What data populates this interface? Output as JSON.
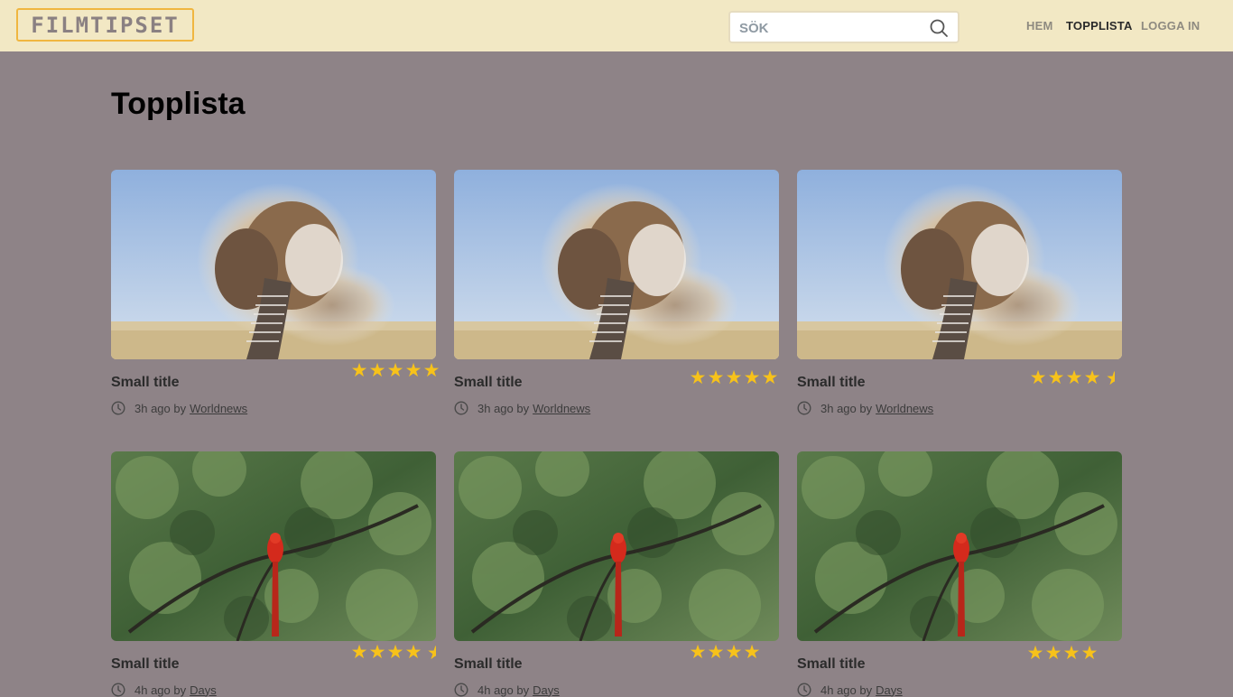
{
  "header": {
    "logo": "FILMTIPSET",
    "search_placeholder": "SÖK",
    "nav": {
      "home": "HEM",
      "toplist": "TOPPLISTA",
      "login": "LOGGA IN"
    }
  },
  "page_title": "Topplista",
  "cards": [
    {
      "title": "Small title",
      "time": "3h ago by",
      "author": "Worldnews",
      "rating": 5,
      "image": "elephant"
    },
    {
      "title": "Small title",
      "time": "3h ago by",
      "author": "Worldnews",
      "rating": 5,
      "image": "elephant"
    },
    {
      "title": "Small title",
      "time": "3h ago by",
      "author": "Worldnews",
      "rating": 4.5,
      "image": "elephant"
    },
    {
      "title": "Small title",
      "time": "4h ago by",
      "author": "Days",
      "rating": 4.5,
      "image": "parrot"
    },
    {
      "title": "Small title",
      "time": "4h ago by",
      "author": "Days",
      "rating": 4,
      "image": "parrot"
    },
    {
      "title": "Small title",
      "time": "4h ago by",
      "author": "Days",
      "rating": 4,
      "image": "parrot"
    }
  ],
  "colors": {
    "header_bg": "#f2e8c4",
    "page_bg": "#8e8387",
    "star": "#f7c21a",
    "logo_border": "#f0b640"
  }
}
